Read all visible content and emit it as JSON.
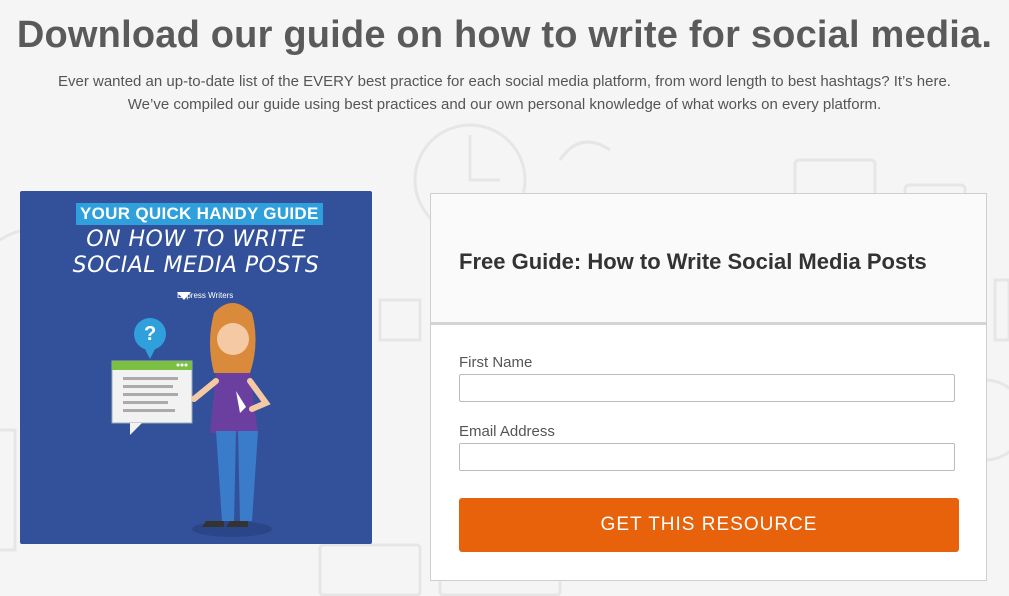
{
  "page": {
    "headline": "Download our guide on how to write for social media.",
    "subtitle_line1": "Ever wanted an up-to-date list of the EVERY best practice for each social media platform, from word length to best hashtags? It’s here.",
    "subtitle_line2": "We’ve compiled our guide using best practices and our own personal knowledge of what works on every platform."
  },
  "cover": {
    "tag": "YOUR QUICK HANDY GUIDE",
    "title_line1": "ON HOW TO WRITE",
    "title_line2": "SOCIAL MEDIA POSTS",
    "brand": "Express Writers",
    "question_mark": "?",
    "icon": "woman-with-chat-window-illustration"
  },
  "form": {
    "title": "Free Guide: How to Write Social Media Posts",
    "first_name_label": "First Name",
    "first_name_value": "",
    "email_label": "Email Address",
    "email_value": "",
    "submit_label": "GET THIS RESOURCE"
  },
  "colors": {
    "background": "#f5f5f5",
    "cover_blue": "#33519a",
    "button_orange": "#e7620a"
  }
}
